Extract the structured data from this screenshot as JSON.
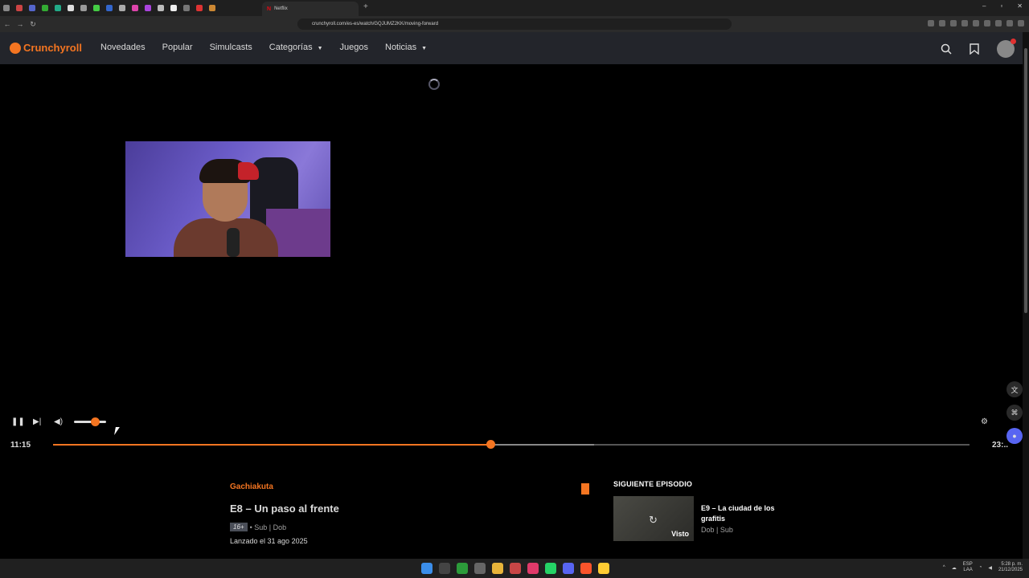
{
  "browser": {
    "active_tab_label": "Netflix",
    "url": "crunchyroll.com/es-es/watch/GQJUMZ2KK/moving-forward",
    "new_tab_label": "+",
    "window_controls": [
      "–",
      "▫",
      "✕"
    ]
  },
  "header": {
    "logo_text": "Crunchyroll",
    "nav": [
      {
        "label": "Novedades"
      },
      {
        "label": "Popular"
      },
      {
        "label": "Simulcasts"
      },
      {
        "label": "Categorías",
        "dropdown": true
      },
      {
        "label": "Juegos"
      },
      {
        "label": "Noticias",
        "dropdown": true
      }
    ]
  },
  "player": {
    "current_time": "11:15",
    "duration": "23:..",
    "progress_fraction": 0.477,
    "buffer_fraction": 0.59,
    "volume_fraction": 0.65
  },
  "episode": {
    "series": "Gachiakuta",
    "title": "E8 – Un paso al frente",
    "rating": "16+",
    "audio": "• Sub | Dob",
    "released": "Lanzado el 31 ago 2025"
  },
  "next_episode": {
    "heading": "SIGUIENTE EPISODIO",
    "title": "E9 – La ciudad de los grafitis",
    "sub": "Dob | Sub",
    "badge": "Visto"
  },
  "taskbar": {
    "lang": "ESP",
    "lang2": "LAA",
    "time": "5:28 p. m.",
    "date": "21/12/2025"
  },
  "colors": {
    "accent": "#f47521",
    "header_bg": "#23252b"
  }
}
